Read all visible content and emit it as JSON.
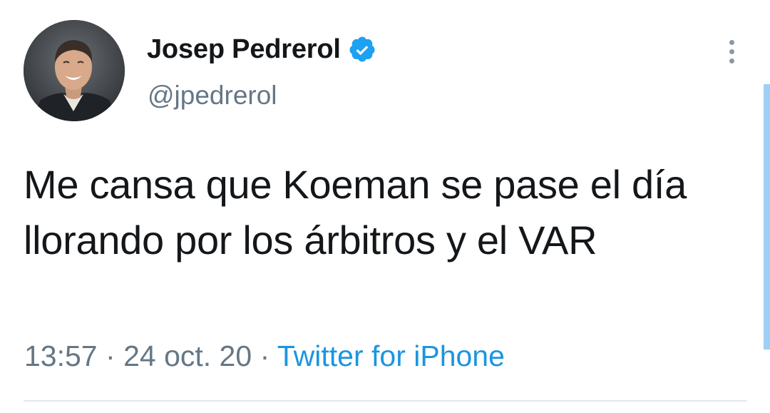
{
  "user": {
    "display_name": "Josep Pedrerol",
    "handle": "@jpedrerol",
    "verified": true,
    "avatar_icon": "profile-photo"
  },
  "tweet": {
    "text": "Me cansa que Koeman se pase el día llorando por los árbitros y el VAR",
    "time": "13:57",
    "date": "24 oct. 20",
    "separator": "·",
    "source": "Twitter for iPhone"
  },
  "icons": {
    "verified": "verified-badge-icon",
    "more": "more-vertical-icon"
  },
  "colors": {
    "accent": "#1b95e0",
    "verified": "#1da1f2",
    "secondary_text": "#657786",
    "primary_text": "#14171a"
  }
}
